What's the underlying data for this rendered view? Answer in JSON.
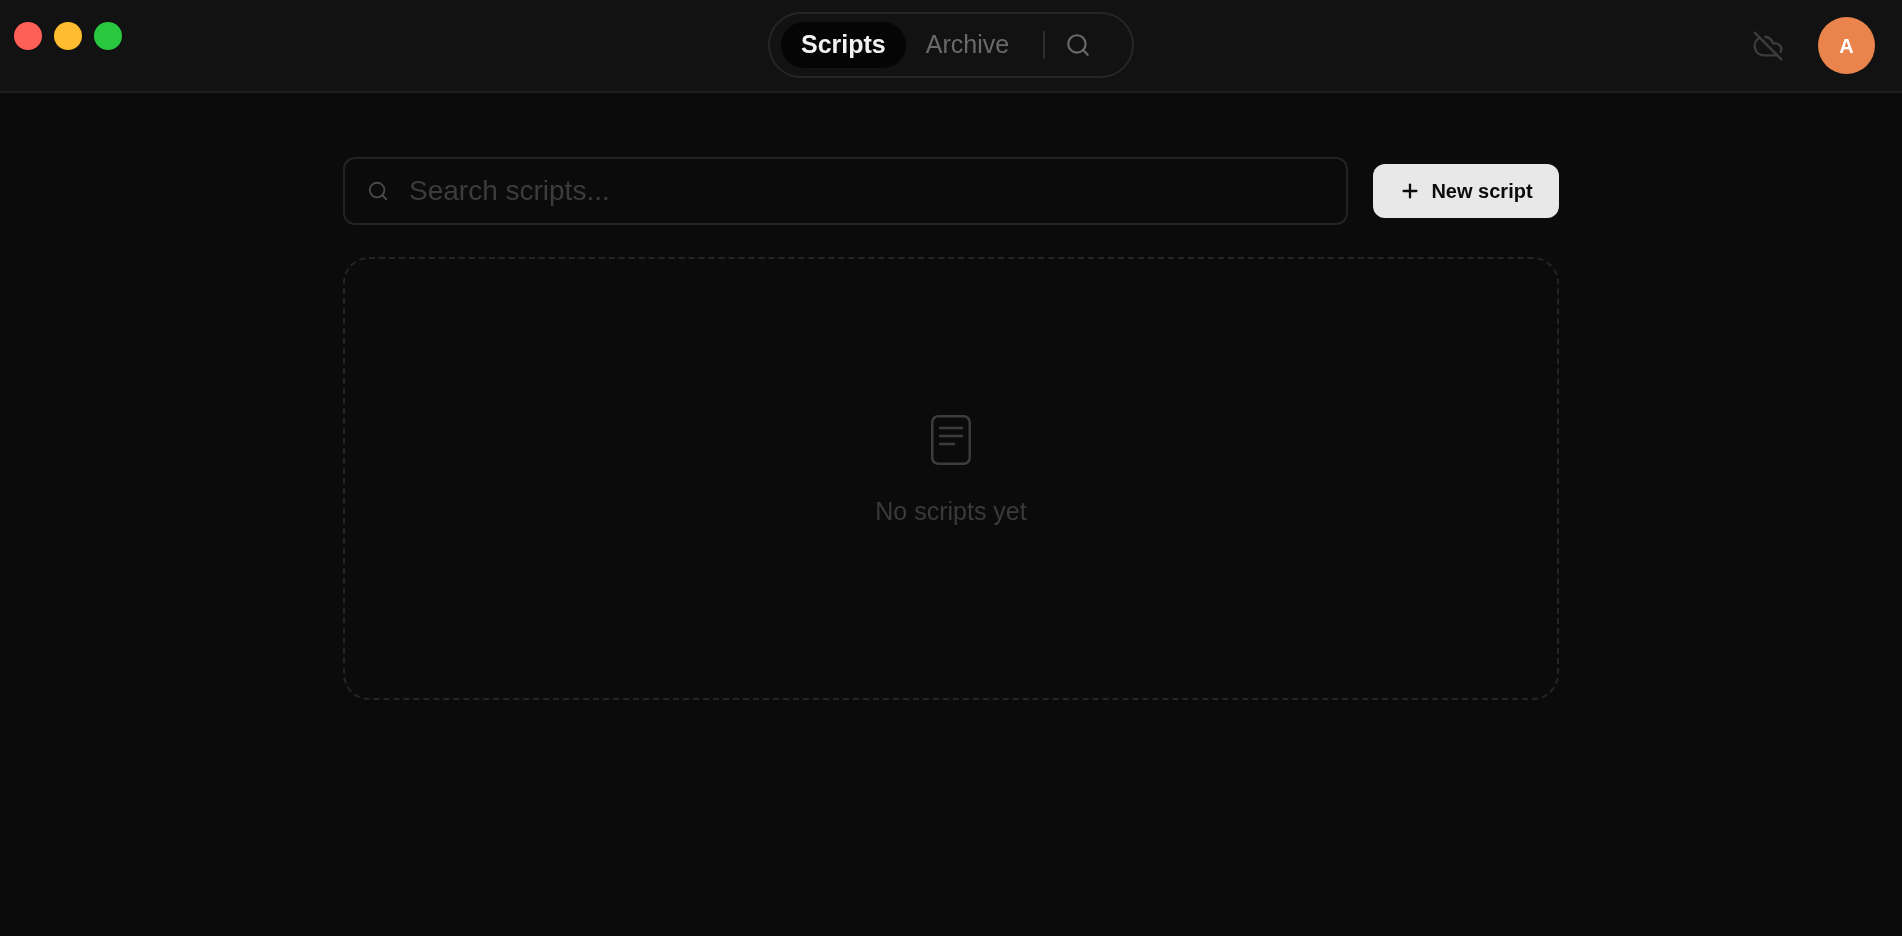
{
  "window_controls": [
    {
      "color": "#fe5f57"
    },
    {
      "color": "#febc2e"
    },
    {
      "color": "#28c840"
    }
  ],
  "tabs": [
    {
      "label": "Scripts",
      "selected": true
    },
    {
      "label": "Archive",
      "selected": false
    }
  ],
  "avatar": {
    "initial": "A"
  },
  "search": {
    "placeholder": "Search scripts..."
  },
  "new_button": {
    "label": "New script"
  },
  "empty_state": {
    "message": "No scripts yet"
  }
}
